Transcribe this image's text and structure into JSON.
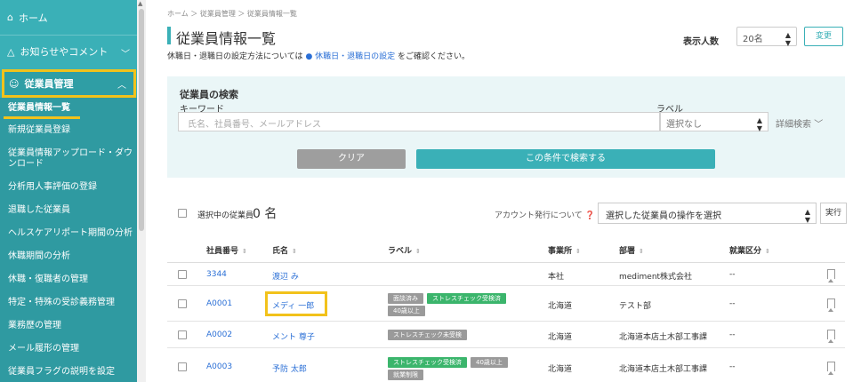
{
  "sidebar": {
    "home": "ホーム",
    "notice": "お知らせやコメント",
    "group": "従業員管理",
    "items": [
      "従業員情報一覧",
      "新規従業員登録",
      "従業員情報アップロード・ダウンロード",
      "分析用人事評価の登録",
      "退職した従業員",
      "ヘルスケアリポート期間の分析",
      "休職期間の分析",
      "休職・復職者の管理",
      "特定・特殊の受診義務管理",
      "業務歴の管理",
      "メール履形の管理",
      "従業員フラグの説明を設定"
    ]
  },
  "breadcrumb": "ホーム ＞ 従業員管理 ＞ 従業員情報一覧",
  "page": {
    "title": "従業員情報一覧",
    "hint_prefix": "休職日・退職日の設定方法については",
    "hint_link": "休職日・退職日の設定",
    "hint_suffix": "をご確認ください。",
    "display_label": "表示人数",
    "display_value": "20名",
    "change_label": "変更"
  },
  "search": {
    "title": "従業員の検索",
    "keyword_label": "キーワード",
    "keyword_placeholder": "氏名、社員番号、メールアドレス",
    "label_label": "ラベル",
    "label_value": "選択なし",
    "advanced": "詳細検索",
    "clear": "クリア",
    "submit": "この条件で検索する"
  },
  "selection": {
    "label": "選択中の従業員",
    "count": "0 名",
    "account": "アカウント発行について",
    "op_value": "選択した従業員の操作を選択",
    "exec": "実行"
  },
  "table": {
    "headers": [
      "社員番号",
      "氏名",
      "ラベル",
      "事業所",
      "部署",
      "就業区分"
    ],
    "rows": [
      {
        "id": "3344",
        "name": "渡辺 み",
        "tags": [],
        "office": "本社",
        "dept": "mediment株式会社",
        "kind": "--"
      },
      {
        "id": "A0001",
        "name": "メディ 一郎",
        "tags": [
          {
            "t": "面談済み",
            "c": "gray"
          },
          {
            "t": "ストレスチェック受検済",
            "c": "green"
          },
          {
            "t": "40歳以上",
            "c": "gray"
          }
        ],
        "office": "北海道",
        "dept": "テスト部",
        "kind": "--"
      },
      {
        "id": "A0002",
        "name": "メント 尊子",
        "tags": [
          {
            "t": "ストレスチェック未受検",
            "c": "gray"
          }
        ],
        "office": "北海道",
        "dept": "北海道本店土木部工事課",
        "kind": "--"
      },
      {
        "id": "A0003",
        "name": "予防 太郎",
        "tags": [
          {
            "t": "ストレスチェック受検済",
            "c": "green"
          },
          {
            "t": "40歳以上",
            "c": "gray"
          },
          {
            "t": "就業制限",
            "c": "gray"
          }
        ],
        "office": "北海道",
        "dept": "北海道本店土木部工事課",
        "kind": "--"
      }
    ]
  }
}
